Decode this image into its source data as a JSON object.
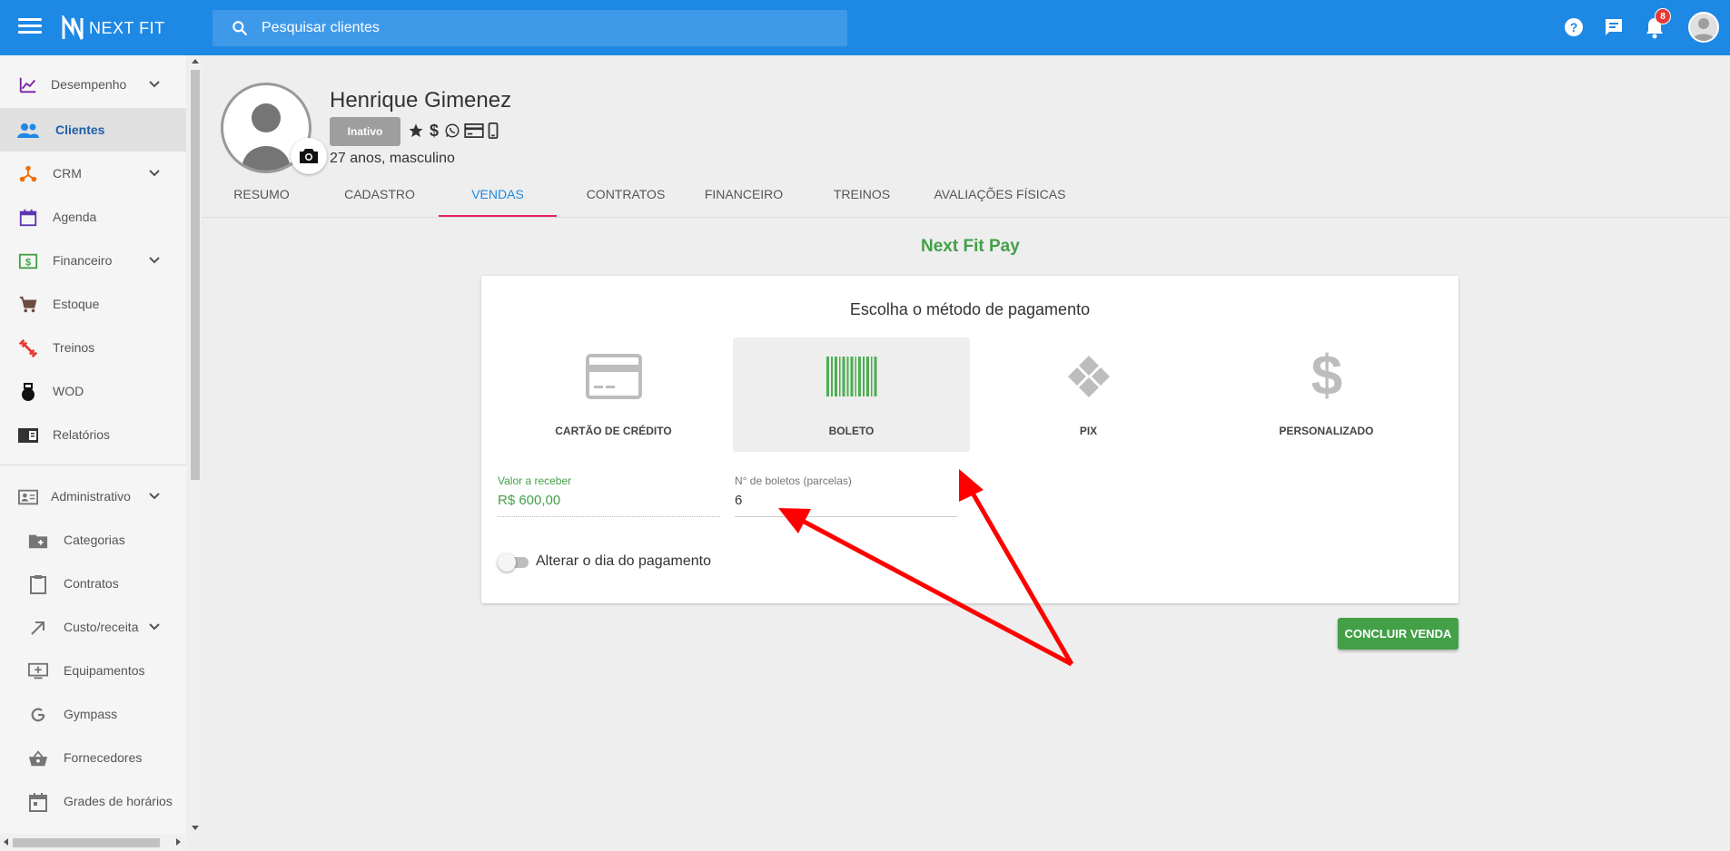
{
  "app": {
    "logo_text": "NEXT FIT",
    "search_placeholder": "Pesquisar clientes",
    "notification_count": "8"
  },
  "sidebar": {
    "items": [
      {
        "label": "Desempenho",
        "icon": "trending-up-icon",
        "has_chevron": true
      },
      {
        "label": "Clientes",
        "icon": "people-icon",
        "active": true
      },
      {
        "label": "CRM",
        "icon": "hub-icon",
        "has_chevron": true
      },
      {
        "label": "Agenda",
        "icon": "calendar-icon"
      },
      {
        "label": "Financeiro",
        "icon": "money-icon",
        "has_chevron": true
      },
      {
        "label": "Estoque",
        "icon": "cart-icon"
      },
      {
        "label": "Treinos",
        "icon": "fitness-icon"
      },
      {
        "label": "WOD",
        "icon": "kettlebell-icon"
      },
      {
        "label": "Relatórios",
        "icon": "report-icon"
      }
    ],
    "admin": {
      "label": "Administrativo",
      "icon": "id-card-icon"
    },
    "admin_items": [
      {
        "label": "Categorias",
        "icon": "folder-add-icon"
      },
      {
        "label": "Contratos",
        "icon": "clipboard-icon"
      },
      {
        "label": "Custo/receita",
        "icon": "arrow-up-right-icon",
        "has_chevron": true
      },
      {
        "label": "Equipamentos",
        "icon": "monitor-add-icon"
      },
      {
        "label": "Gympass",
        "icon": "google-icon"
      },
      {
        "label": "Fornecedores",
        "icon": "basket-icon"
      },
      {
        "label": "Grades de horários",
        "icon": "calendar-grid-icon"
      }
    ]
  },
  "client": {
    "name": "Henrique Gimenez",
    "status": "Inativo",
    "info": "27 anos, masculino",
    "flags": [
      "star-icon",
      "dollar-icon",
      "whatsapp-icon",
      "credit-card-icon",
      "phone-icon"
    ]
  },
  "tabs": [
    {
      "label": "RESUMO"
    },
    {
      "label": "CADASTRO"
    },
    {
      "label": "VENDAS",
      "active": true
    },
    {
      "label": "CONTRATOS"
    },
    {
      "label": "FINANCEIRO"
    },
    {
      "label": "TREINOS"
    },
    {
      "label": "AVALIAÇÕES FÍSICAS"
    }
  ],
  "payment": {
    "title": "Next Fit Pay",
    "card_title": "Escolha o método de pagamento",
    "methods": [
      {
        "label": "CARTÃO DE CRÉDITO",
        "icon": "credit-card-icon"
      },
      {
        "label": "BOLETO",
        "icon": "barcode-icon",
        "selected": true
      },
      {
        "label": "PIX",
        "icon": "pix-icon"
      },
      {
        "label": "PERSONALIZADO",
        "icon": "dollar-icon"
      }
    ],
    "amount_label": "Valor a receber",
    "amount_value": "R$ 600,00",
    "installments_label": "N° de boletos (parcelas)",
    "installments_value": "6",
    "toggle_label": "Alterar o dia do pagamento",
    "submit_label": "CONCLUIR VENDA"
  },
  "colors": {
    "primary": "#1e88e5",
    "success": "#43a047",
    "tab_indicator": "#e91e63",
    "annotation": "#ff0000"
  }
}
